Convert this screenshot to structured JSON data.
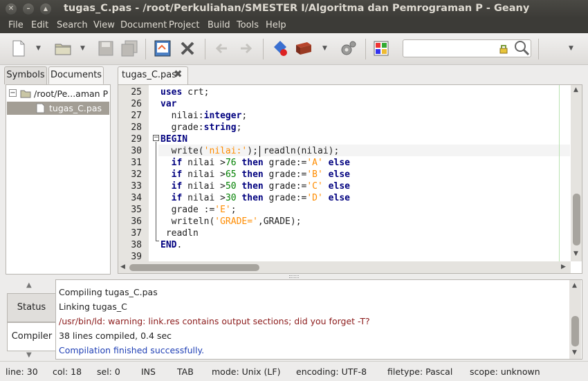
{
  "window": {
    "title": "tugas_C.pas - /root/Perkuliahan/SMESTER I/Algoritma dan Pemrograman P - Geany"
  },
  "menu": [
    "File",
    "Edit",
    "Search",
    "View",
    "Document",
    "Project",
    "Build",
    "Tools",
    "Help"
  ],
  "sidebar": {
    "tabs": [
      "Symbols",
      "Documents"
    ],
    "folder": "/root/Pe...aman P",
    "file": "tugas_C.pas"
  },
  "editor": {
    "tab": "tugas_C.pas",
    "line_numbers": [
      "25",
      "26",
      "27",
      "28",
      "29",
      "30",
      "31",
      "32",
      "33",
      "34",
      "35",
      "36",
      "37",
      "38",
      "39"
    ]
  },
  "messages": {
    "tabs": [
      "Status",
      "Compiler"
    ],
    "lines": [
      {
        "text": "Compiling tugas_C.pas",
        "color": "#222222"
      },
      {
        "text": "Linking tugas_C",
        "color": "#222222"
      },
      {
        "text": "/usr/bin/ld: warning: link.res contains output sections; did you forget -T?",
        "color": "#8b1a1a"
      },
      {
        "text": "38 lines compiled, 0.4 sec",
        "color": "#222222"
      },
      {
        "text": "Compilation finished successfully.",
        "color": "#1f3fb5"
      }
    ]
  },
  "status": {
    "line": "line: 30",
    "col": "col: 18",
    "sel": "sel: 0",
    "ins": "INS",
    "tab": "TAB",
    "mode": "mode: Unix (LF)",
    "encoding": "encoding: UTF-8",
    "filetype": "filetype: Pascal",
    "scope": "scope: unknown"
  },
  "colors": {
    "keyword": "#00007f",
    "string": "#ff8c00",
    "number": "#008000"
  }
}
